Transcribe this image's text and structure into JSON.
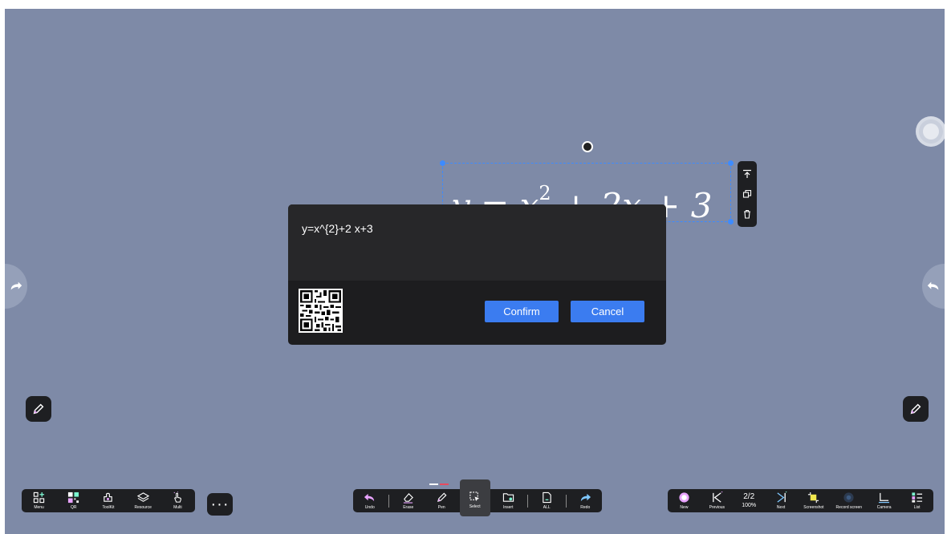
{
  "formula": {
    "input_text": "y=x^{2}+2 x+3",
    "rendered_base": "y = x",
    "rendered_exp": "2",
    "rendered_tail": " + 2x + 3"
  },
  "dialog": {
    "confirm_label": "Confirm",
    "cancel_label": "Cancel"
  },
  "left_toolbar": [
    {
      "label": "Menu",
      "icon": "menu-icon"
    },
    {
      "label": "QR",
      "icon": "qr-icon"
    },
    {
      "label": "ToolKit",
      "icon": "toolkit-icon"
    },
    {
      "label": "Resource",
      "icon": "resource-icon"
    },
    {
      "label": "Multi",
      "icon": "multi-touch-icon"
    }
  ],
  "more_label": "···",
  "center_toolbar": [
    {
      "label": "Undo",
      "icon": "undo-icon"
    },
    {
      "label": "Erase",
      "icon": "eraser-icon"
    },
    {
      "label": "Pen",
      "icon": "pen-icon"
    },
    {
      "label": "Select",
      "icon": "select-icon",
      "active": true
    },
    {
      "label": "Insert",
      "icon": "insert-icon"
    },
    {
      "label": "ALL",
      "icon": "all-icon"
    },
    {
      "label": "Redo",
      "icon": "redo-icon"
    }
  ],
  "right_toolbar": {
    "new_label": "New",
    "previous_label": "Previous",
    "page": "2/2",
    "zoom": "100%",
    "next_label": "Next",
    "screenshot_label": "Screenshot",
    "record_label": "Record screen",
    "camera_label": "Camera",
    "list_label": "List"
  },
  "colors": {
    "canvas": "#7e8aa7",
    "accent": "#3b7cf0",
    "selection": "#3d8bff",
    "toolbar": "#1e1f22"
  }
}
